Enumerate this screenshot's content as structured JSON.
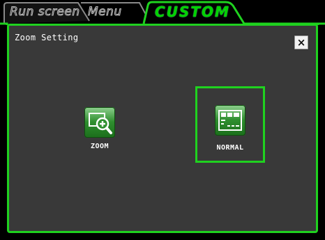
{
  "tabs": [
    {
      "label": "Run screen",
      "active": false
    },
    {
      "label": "Menu",
      "active": false
    },
    {
      "label": "CUSTOM",
      "active": true
    }
  ],
  "panel": {
    "title": "Zoom Setting",
    "close_label": "×"
  },
  "options": [
    {
      "label": "ZOOM",
      "icon": "zoom-in-icon",
      "selected": false
    },
    {
      "label": "NORMAL",
      "icon": "screen-layout-icon",
      "selected": true
    }
  ],
  "colors": {
    "accent": "#1fd21f",
    "panel_bg": "#393939",
    "icon_green": "#2f8f2f"
  }
}
